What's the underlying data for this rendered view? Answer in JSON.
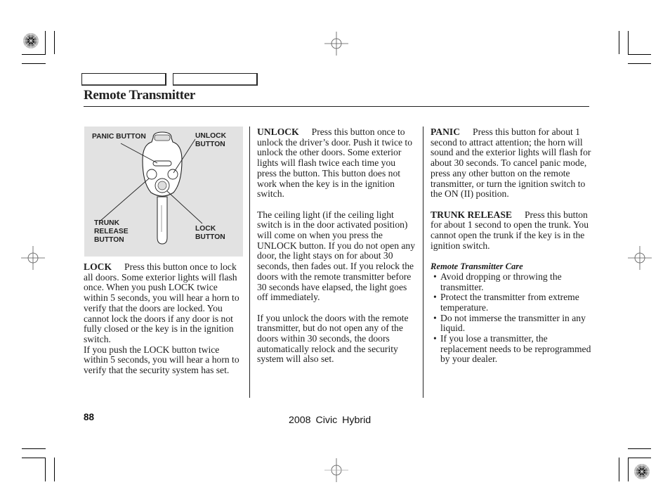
{
  "header": {
    "nav_tabs": [
      "",
      ""
    ],
    "title": "Remote Transmitter"
  },
  "figure": {
    "labels": {
      "panic": "PANIC BUTTON",
      "unlock": "UNLOCK\nBUTTON",
      "trunk": "TRUNK\nRELEASE\nBUTTON",
      "lock": "LOCK\nBUTTON"
    }
  },
  "columns": {
    "left": {
      "lock_keyword": "LOCK",
      "lock_text": "Press this button once to lock all doors. Some exterior lights will flash once. When you push LOCK twice within 5 seconds, you will hear a horn to verify that the doors are locked. You cannot lock the doors if any door is not fully closed or the key is in the ignition switch.",
      "lock_text_2": "If you push the LOCK button twice within 5 seconds, you will hear a horn to verify that the security system has set."
    },
    "middle": {
      "unlock_keyword": "UNLOCK",
      "unlock_text": "Press this button once to unlock the driver’s door. Push it twice to unlock the other doors. Some exterior lights will flash twice each time you press the button. This button does not work when the key is in the ignition switch.",
      "ceiling_text": "The ceiling light (if the ceiling light switch is in the door activated position) will come on when you press the UNLOCK button. If you do not open any door, the light stays on for about 30 seconds, then fades out. If you relock the doors with the remote transmitter before 30 seconds have elapsed, the light goes off immediately.",
      "relock_text": "If you unlock the doors with the remote transmitter, but do not open any of the doors within 30 seconds, the doors automatically relock and the security system will also set."
    },
    "right": {
      "panic_keyword": "PANIC",
      "panic_text": "Press this button for about 1 second to attract attention; the horn will sound and the exterior lights will flash for about 30 seconds. To cancel panic mode, press any other button on the remote transmitter, or turn the ignition switch to the ON (II) position.",
      "trunk_keyword": "TRUNK RELEASE",
      "trunk_text": "Press this button for about 1 second to open the trunk. You cannot open the trunk if the key is in the ignition switch.",
      "care_title": "Remote Transmitter Care",
      "care_items": [
        "Avoid dropping or throwing the transmitter.",
        "Protect the transmitter from extreme temperature.",
        "Do not immerse the transmitter in any liquid.",
        "If you lose a transmitter, the replacement needs to be reprogrammed by your dealer."
      ]
    }
  },
  "footer": {
    "page_number": "88",
    "book_title": "2008  Civic  Hybrid"
  }
}
